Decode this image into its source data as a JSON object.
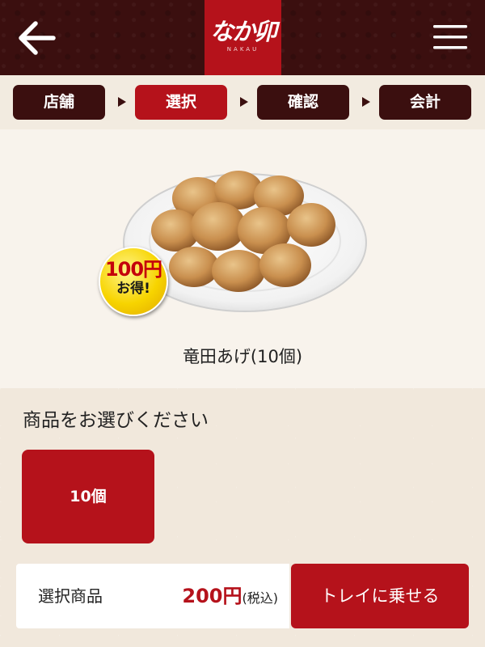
{
  "header": {
    "back_icon": "arrow-left-icon",
    "menu_icon": "hamburger-menu-icon",
    "logo_text": "なか卯",
    "logo_subtext": "NAKAU"
  },
  "steps": [
    {
      "label": "店舗",
      "active": false
    },
    {
      "label": "選択",
      "active": true
    },
    {
      "label": "確認",
      "active": false
    },
    {
      "label": "会計",
      "active": false
    }
  ],
  "product": {
    "name": "竜田あげ(10個)",
    "badge": {
      "amount": "100円",
      "text": "お得!"
    }
  },
  "selection": {
    "title": "商品をお選びください",
    "options": [
      "10個"
    ]
  },
  "footer": {
    "selected_label": "選択商品",
    "price": "200円",
    "tax_note": "(税込)",
    "add_to_tray": "トレイに乗せる"
  },
  "colors": {
    "header_bg": "#3b0f0f",
    "accent_red": "#b5121b",
    "badge_yellow": "#f7d400",
    "page_bg": "#f4ede2"
  }
}
